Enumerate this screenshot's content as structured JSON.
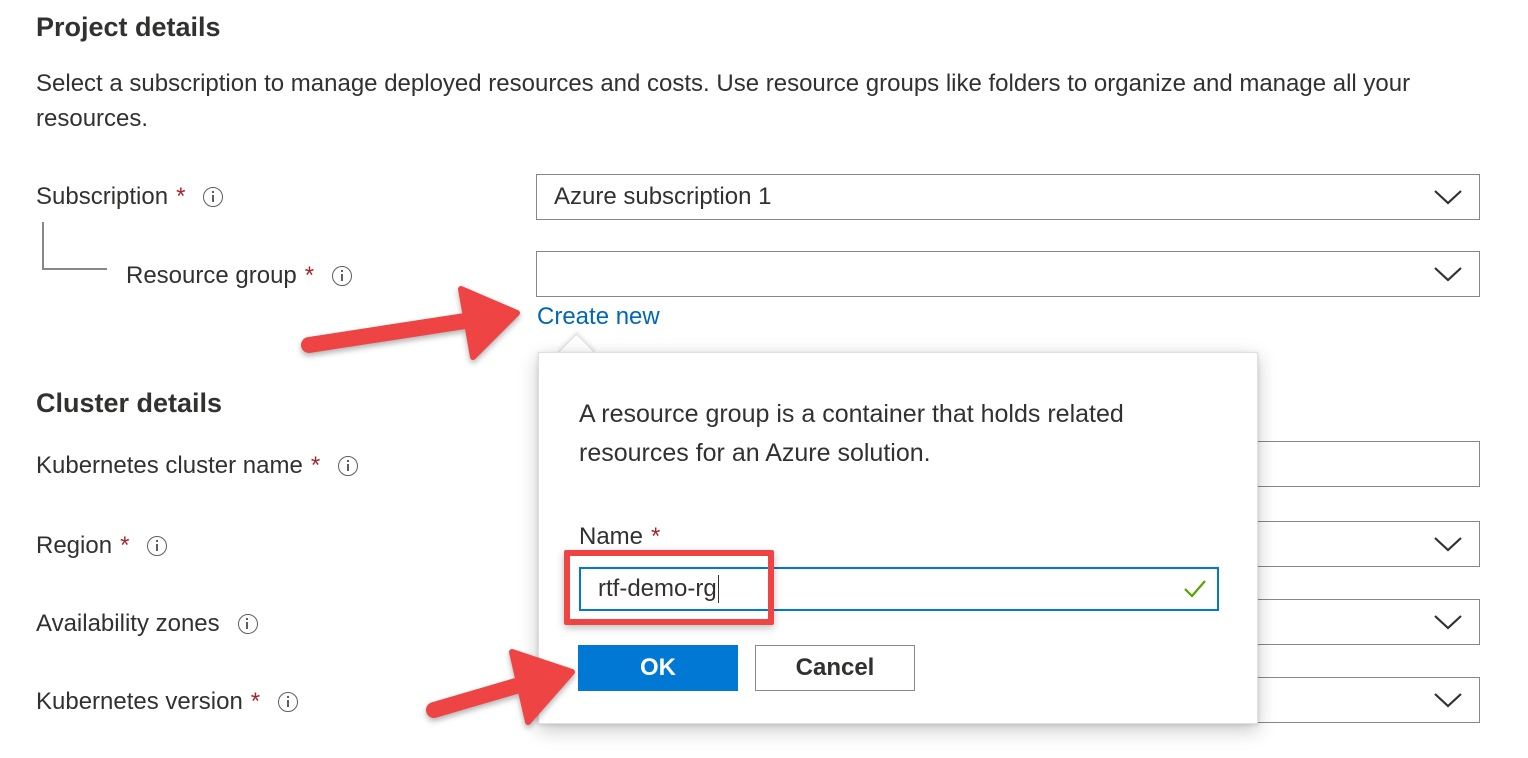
{
  "project": {
    "title": "Project details",
    "description": "Select a subscription to manage deployed resources and costs. Use resource groups like folders to organize and manage all your resources."
  },
  "subscription": {
    "label": "Subscription",
    "required": "*",
    "value": "Azure subscription 1"
  },
  "resource_group": {
    "label": "Resource group",
    "required": "*",
    "value": "",
    "create_new": "Create new"
  },
  "cluster": {
    "title": "Cluster details",
    "name_label": "Kubernetes cluster name",
    "region_label": "Region",
    "zones_label": "Availability zones",
    "version_label": "Kubernetes version",
    "required": "*"
  },
  "callout": {
    "text": "A resource group is a container that holds related resources for an Azure solution.",
    "name_label": "Name",
    "required": "*",
    "name_value": "rtf-demo-rg",
    "ok_label": "OK",
    "cancel_label": "Cancel"
  },
  "colors": {
    "accent": "#0078d4",
    "link": "#0067b8",
    "required": "#a4262c",
    "annotation": "#ef4444",
    "valid": "#57a300"
  }
}
